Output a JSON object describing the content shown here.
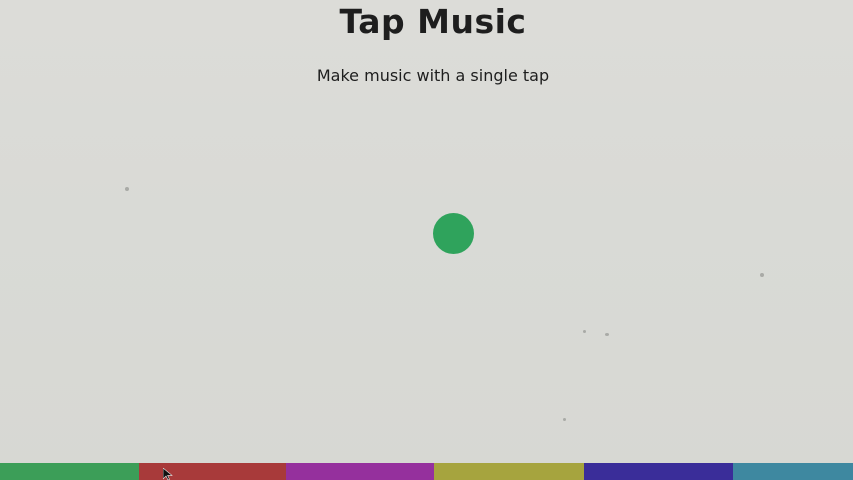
{
  "app": {
    "title": "Tap Music",
    "subtitle": "Make music with a single tap"
  },
  "tap_target": {
    "icon": "filled-circle",
    "color": "#2fa35c"
  },
  "color_bar": {
    "segments": [
      {
        "color": "#3c9e58"
      },
      {
        "color": "#a83a3a"
      },
      {
        "color": "#95309d"
      },
      {
        "color": "#a6a43e"
      },
      {
        "color": "#3a2d99"
      },
      {
        "color": "#3e88a0"
      }
    ]
  },
  "cursor": {
    "icon": "arrow-cursor"
  }
}
